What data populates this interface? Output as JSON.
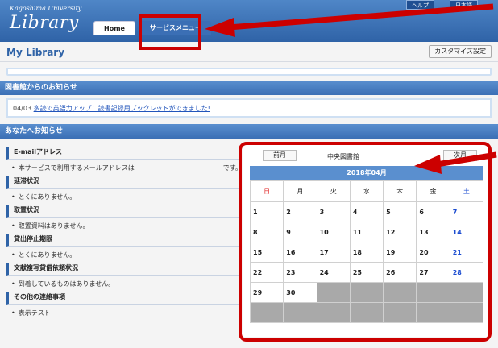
{
  "header": {
    "logo_sub": "Kagoshima University",
    "logo_main": "Library",
    "top_btn1": "ヘルプ",
    "top_btn2": "日本語",
    "nav": {
      "home": "Home",
      "service_menu": "サービスメニュー"
    }
  },
  "page": {
    "title": "My Library",
    "customize": "カスタマイズ設定"
  },
  "library_news": {
    "header": "図書館からのお知らせ",
    "date": "04/03",
    "link_text": "多読で英語力アップ！読書記録用ブックレットができました!"
  },
  "user_notices": {
    "header": "あなたへお知らせ",
    "sections": [
      {
        "title": "E-mailアドレス",
        "item": "本サービスで利用するメールアドレスは",
        "item_suffix": "です。"
      },
      {
        "title": "延滞状況",
        "item": "とくにありません。"
      },
      {
        "title": "取置状況",
        "item": "取置資料はありません。"
      },
      {
        "title": "貸出停止期限",
        "item": "とくにありません。"
      },
      {
        "title": "文献複写貸借依頼状況",
        "item": "到着しているものはありません。"
      },
      {
        "title": "その他の連絡事項",
        "item": "表示テスト"
      }
    ]
  },
  "calendar": {
    "prev": "前月",
    "next": "次月",
    "library": "中央図書館",
    "month": "2018年04月",
    "weekdays": [
      "日",
      "月",
      "火",
      "水",
      "木",
      "金",
      "土"
    ],
    "weeks": [
      [
        "1",
        "2",
        "3",
        "4",
        "5",
        "6",
        "7"
      ],
      [
        "8",
        "9",
        "10",
        "11",
        "12",
        "13",
        "14"
      ],
      [
        "15",
        "16",
        "17",
        "18",
        "19",
        "20",
        "21"
      ],
      [
        "22",
        "23",
        "24",
        "25",
        "26",
        "27",
        "28"
      ],
      [
        "29",
        "30",
        "",
        "",
        "",
        "",
        ""
      ],
      [
        "",
        "",
        "",
        "",
        "",
        "",
        ""
      ]
    ]
  },
  "colors": {
    "accent": "#3b6fb5",
    "annotation": "#cc0000"
  }
}
